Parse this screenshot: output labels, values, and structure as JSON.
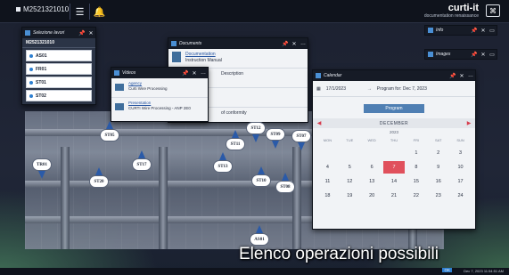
{
  "header": {
    "machine_code": "M2521321010",
    "brand_name": "curti-it",
    "brand_tagline": "documentation renaissance"
  },
  "panels": {
    "station_list": {
      "title": "Selezione lavori",
      "selected": "M2521321010",
      "items": [
        "AS01",
        "FR01",
        "ST01",
        "ST02"
      ]
    },
    "documents": {
      "title": "Documents",
      "rows": [
        {
          "title": "Documentation",
          "subtitle": "Instruction Manual"
        },
        {
          "title": "",
          "subtitle": "Description"
        },
        {
          "title": "",
          "subtitle": ""
        },
        {
          "title": "",
          "subtitle": "of conformity"
        }
      ]
    },
    "videos": {
      "title": "Videos",
      "rows": [
        {
          "title": "Agency",
          "subtitle": "Curti Wire Processing"
        },
        {
          "title": "Presentation",
          "subtitle": "CURTI Wire Processing - ANP 2E0"
        }
      ]
    },
    "calendar": {
      "title": "Calendar",
      "date_value": "17/1/2023",
      "program_for": "Program for: Dec 7, 2023",
      "program_button": "Program",
      "month_label": "DECEMBER",
      "year_label": "2023",
      "dow": [
        "MON",
        "TUE",
        "WED",
        "THU",
        "FRI",
        "SAT",
        "SUN"
      ],
      "weeks": [
        [
          "",
          "",
          "",
          "",
          "1",
          "2",
          "3"
        ],
        [
          "4",
          "5",
          "6",
          "7",
          "8",
          "9",
          "10"
        ],
        [
          "11",
          "12",
          "13",
          "14",
          "15",
          "16",
          "17"
        ],
        [
          "18",
          "19",
          "20",
          "21",
          "22",
          "23",
          "24"
        ]
      ],
      "selected_day": "7"
    },
    "tiles": {
      "info": "Info",
      "images": "Images"
    }
  },
  "stations": [
    "TR01",
    "ST20",
    "ST17",
    "ST13",
    "ST11",
    "ST12",
    "ST09",
    "ST10",
    "ST07",
    "ST08",
    "ST05",
    "AS01"
  ],
  "caption": "Elenco operazioni possibili",
  "footer": {
    "ok_label": "OK",
    "timestamp": "Dec 7, 2023 11:54:51 AM"
  },
  "colors": {
    "accent": "#2d7fd0",
    "selected_day": "#e0505c",
    "pin": "#2a5aa8"
  }
}
